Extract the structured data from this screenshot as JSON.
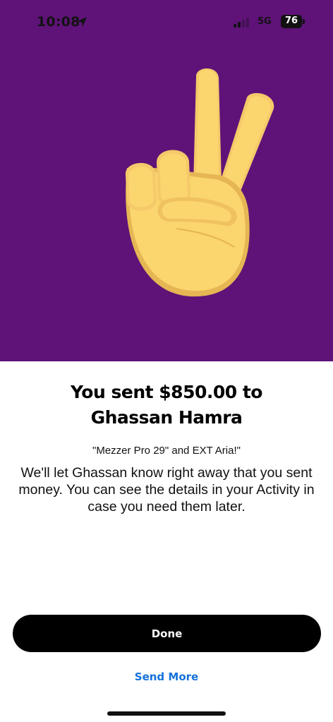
{
  "status_bar": {
    "time": "10:08",
    "network": "5G",
    "battery_percent": "76",
    "icons": [
      "location-arrow-icon",
      "signal-bars-icon",
      "battery-icon"
    ]
  },
  "hero": {
    "background_color": "#5f1378",
    "illustration": "peace-hand-icon"
  },
  "confirmation": {
    "headline_line1": "You sent $850.00 to",
    "headline_line2": "Ghassan Hamra",
    "note": "\"Mezzer Pro 29\" and EXT Aria!\"",
    "message": "We'll let Ghassan know right away that you sent money. You can see the details in your Activity in case you need them later."
  },
  "actions": {
    "done_label": "Done",
    "send_more_label": "Send More",
    "link_color": "#1672d9"
  }
}
